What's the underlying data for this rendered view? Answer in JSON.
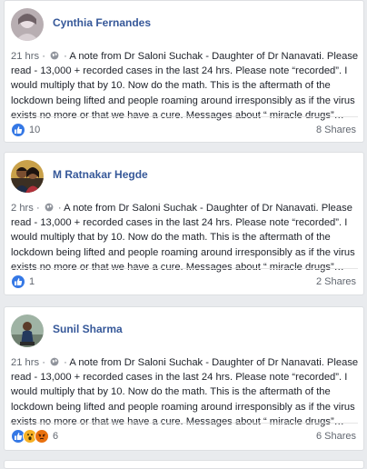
{
  "posts": [
    {
      "author": "Cynthia Fernandes",
      "time": "21 hrs",
      "body": "A note from Dr Saloni Suchak - Daughter of Dr Nanavati. Please read - 13,000 + recorded cases in the last 24 hrs. Please note “recorded”. I would multiply that by 10. Now do the math. This is the aftermath of the lockdown being lifted and people roaming around irresponsibly as if the virus exists no more or that we have a cure. Messages about “ miracle drugs”…",
      "reaction_count": "10",
      "shares": "8 Shares",
      "reactions": [
        "like-icon"
      ]
    },
    {
      "author": "M Ratnakar Hegde",
      "time": "2 hrs",
      "body": "A note from Dr Saloni Suchak - Daughter of Dr Nanavati. Please read - 13,000 + recorded cases in the last 24 hrs. Please note “recorded”. I would multiply that by 10. Now do the math. This is the aftermath of the lockdown being lifted and people roaming around irresponsibly as if the virus exists no more or that we have a cure. Messages about “ miracle drugs”…",
      "reaction_count": "1",
      "shares": "2 Shares",
      "reactions": [
        "like-icon"
      ]
    },
    {
      "author": "Sunil Sharma",
      "time": "21 hrs",
      "body": "A note from Dr Saloni Suchak - Daughter of Dr Nanavati. Please read - 13,000 + recorded cases in the last 24 hrs. Please note “recorded”. I would multiply that by 10. Now do the math. This is the aftermath of the lockdown being lifted and people roaming around irresponsibly as if the virus exists no more or that we have a cure. Messages about “ miracle drugs”…",
      "reaction_count": "6",
      "shares": "6 Shares",
      "reactions": [
        "like-icon",
        "wow-icon",
        "angry-icon"
      ]
    }
  ],
  "colors": {
    "author": "#365899",
    "like": "#3578e5",
    "wow": "#f7b125",
    "angry": "#e9710f",
    "background": "#e9ebee"
  }
}
